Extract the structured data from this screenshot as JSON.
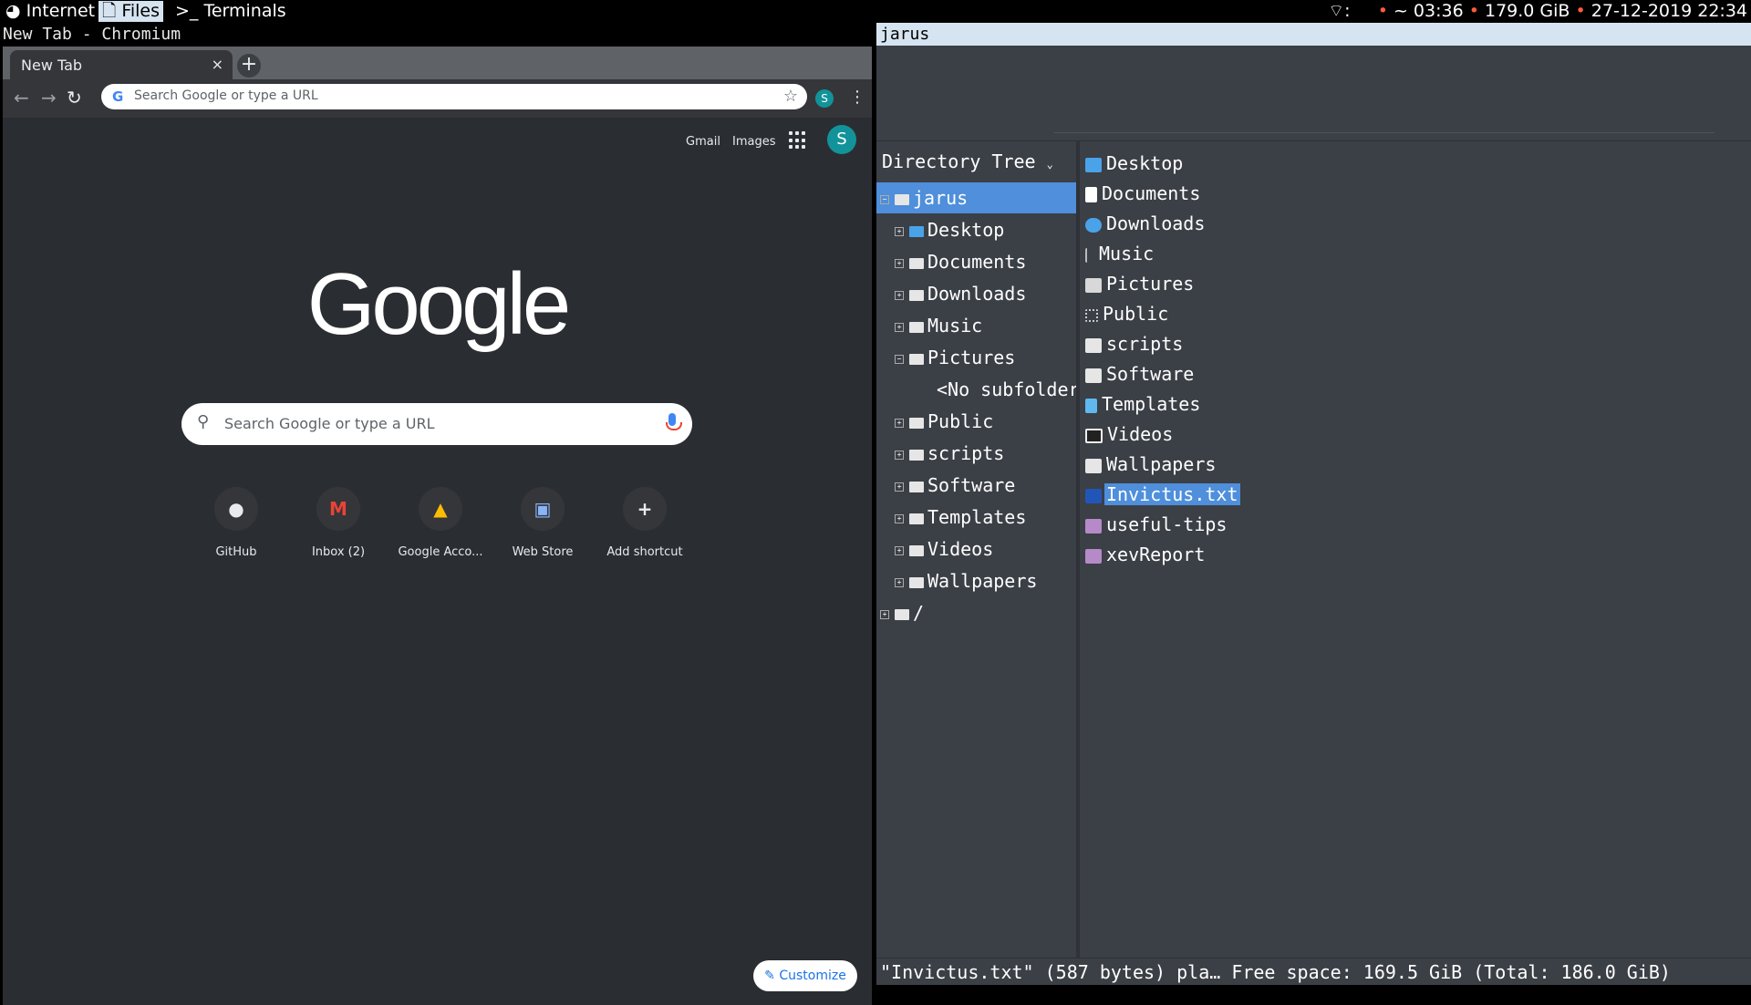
{
  "topbar": {
    "workspaces": [
      {
        "icon": "globe-icon",
        "label": "Internet",
        "active": false
      },
      {
        "icon": "file-icon",
        "label": "Files",
        "active": true
      },
      {
        "icon": "terminal-icon",
        "label": "Terminals",
        "active": false
      }
    ],
    "status": {
      "wifi_icon": "wifi-icon",
      "wifi_sep": ":",
      "home": "~ 03:36",
      "disk": "179.0 GiB",
      "datetime": "27-12-2019 22:34",
      "dot": "•"
    }
  },
  "chromium": {
    "window_title": "New Tab - Chromium",
    "tab_title": "New Tab",
    "tab_close": "×",
    "new_tab": "+",
    "omnibox_placeholder": "Search Google or type a URL",
    "profile_initial": "S",
    "ntp": {
      "gmail": "Gmail",
      "images": "Images",
      "avatar_initial": "S",
      "logo": "Google",
      "search_placeholder": "Search Google or type a URL",
      "shortcuts": [
        {
          "name": "GitHub",
          "icon": "github-icon",
          "glyph": "●"
        },
        {
          "name": "Inbox (2)",
          "icon": "gmail-icon",
          "glyph": "M"
        },
        {
          "name": "Google Acco...",
          "icon": "google-drive-icon",
          "glyph": "▲"
        },
        {
          "name": "Web Store",
          "icon": "web-store-icon",
          "glyph": "▣"
        },
        {
          "name": "Add shortcut",
          "icon": "plus-icon",
          "glyph": "+"
        }
      ],
      "customize": "Customize"
    }
  },
  "filemanager": {
    "window_title": "jarus",
    "tree_header": "Directory Tree",
    "tree": [
      {
        "label": "jarus",
        "expander": "−",
        "selected": true,
        "indent": 0
      },
      {
        "label": "Desktop",
        "expander": "+",
        "indent": 1
      },
      {
        "label": "Documents",
        "expander": "+",
        "indent": 1
      },
      {
        "label": "Downloads",
        "expander": "+",
        "indent": 1
      },
      {
        "label": "Music",
        "expander": "+",
        "indent": 1
      },
      {
        "label": "Pictures",
        "expander": "−",
        "indent": 1
      },
      {
        "label": "<No subfolders>",
        "expander": "",
        "indent": 2
      },
      {
        "label": "Public",
        "expander": "+",
        "indent": 1
      },
      {
        "label": "scripts",
        "expander": "+",
        "indent": 1
      },
      {
        "label": "Software",
        "expander": "+",
        "indent": 1
      },
      {
        "label": "Templates",
        "expander": "+",
        "indent": 1
      },
      {
        "label": "Videos",
        "expander": "+",
        "indent": 1
      },
      {
        "label": "Wallpapers",
        "expander": "+",
        "indent": 1
      },
      {
        "label": "/",
        "expander": "+",
        "indent": 0
      }
    ],
    "files": [
      {
        "name": "Desktop",
        "icon": "desktop-folder-icon",
        "type": "desktop"
      },
      {
        "name": "Documents",
        "icon": "documents-folder-icon",
        "type": "doc"
      },
      {
        "name": "Downloads",
        "icon": "downloads-folder-icon",
        "type": "dl"
      },
      {
        "name": "Music",
        "icon": "music-folder-icon",
        "type": "music"
      },
      {
        "name": "Pictures",
        "icon": "pictures-folder-icon",
        "type": "pics"
      },
      {
        "name": "Public",
        "icon": "public-folder-icon",
        "type": "pub"
      },
      {
        "name": "scripts",
        "icon": "folder-icon",
        "type": "folder"
      },
      {
        "name": "Software",
        "icon": "folder-icon",
        "type": "folder"
      },
      {
        "name": "Templates",
        "icon": "templates-folder-icon",
        "type": "tpl"
      },
      {
        "name": "Videos",
        "icon": "videos-folder-icon",
        "type": "vid"
      },
      {
        "name": "Wallpapers",
        "icon": "folder-icon",
        "type": "folder"
      },
      {
        "name": "Invictus.txt",
        "icon": "text-file-icon",
        "type": "txt",
        "selected": true
      },
      {
        "name": "useful-tips",
        "icon": "executable-icon",
        "type": "exe"
      },
      {
        "name": "xevReport",
        "icon": "executable-icon",
        "type": "exe"
      }
    ],
    "status": "\"Invictus.txt\" (587 bytes) pla… Free space: 169.5 GiB (Total: 186.0 GiB)"
  },
  "colors": {
    "selection": "#4f8fdb",
    "active_workspace": "#d5e4f0",
    "accent_blue": "#1a73e8",
    "avatar_teal": "#12939a"
  }
}
